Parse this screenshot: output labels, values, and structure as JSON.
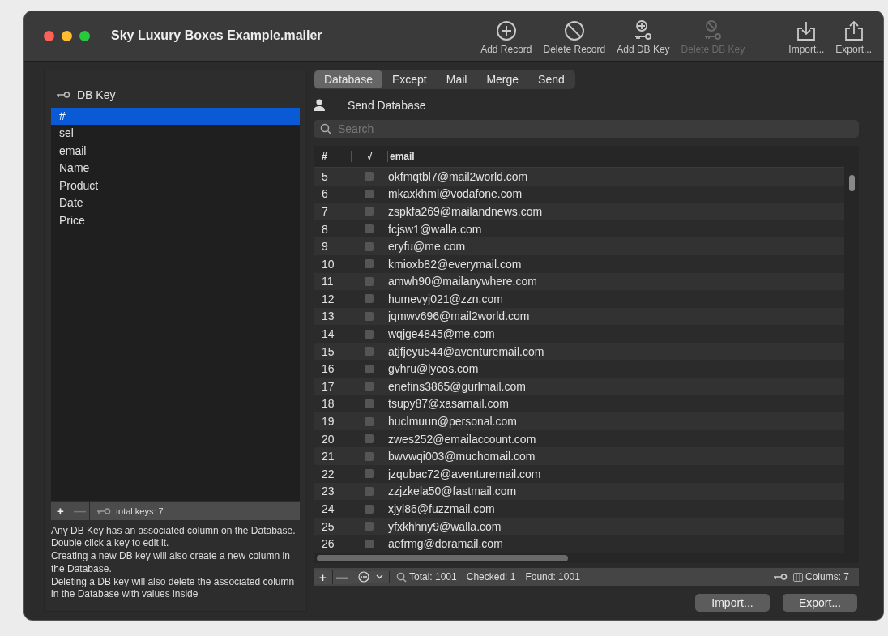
{
  "window": {
    "title": "Sky Luxury Boxes Example.mailer"
  },
  "toolbar": [
    {
      "kind": "add-record",
      "label": "Add Record",
      "disabled": false
    },
    {
      "kind": "delete-record",
      "label": "Delete Record",
      "disabled": false
    },
    {
      "kind": "add-key",
      "label": "Add DB Key",
      "disabled": false
    },
    {
      "kind": "delete-key",
      "label": "Delete DB Key",
      "disabled": true
    },
    {
      "kind": "import",
      "label": "Import...",
      "disabled": false
    },
    {
      "kind": "export",
      "label": "Export...",
      "disabled": false
    }
  ],
  "sidebar": {
    "title": "DB Key",
    "items": [
      {
        "label": "#",
        "selected": true
      },
      {
        "label": "sel",
        "selected": false
      },
      {
        "label": "email",
        "selected": false
      },
      {
        "label": "Name",
        "selected": false
      },
      {
        "label": "Product",
        "selected": false
      },
      {
        "label": "Date",
        "selected": false
      },
      {
        "label": "Price",
        "selected": false
      }
    ],
    "footer": {
      "add": "+",
      "remove": "—",
      "count": "total keys: 7"
    },
    "help": [
      "Any DB Key has an associated column on the Database. Double click a key to edit it.",
      "Creating a new DB key will also create a new column in the Database.",
      "Deleting a DB key will also delete the associated column in the Database with values inside"
    ]
  },
  "tabs": [
    {
      "label": "Database",
      "selected": true
    },
    {
      "label": "Except",
      "selected": false
    },
    {
      "label": "Mail",
      "selected": false
    },
    {
      "label": "Merge",
      "selected": false
    },
    {
      "label": "Send",
      "selected": false
    }
  ],
  "section_title": "Send Database",
  "search": {
    "placeholder": "Search"
  },
  "table": {
    "columns": [
      "#",
      "√",
      "email"
    ],
    "rows": [
      {
        "n": "5",
        "checked": false,
        "email": "okfmqtbl7@mail2world.com"
      },
      {
        "n": "6",
        "checked": false,
        "email": "mkaxkhml@vodafone.com"
      },
      {
        "n": "7",
        "checked": false,
        "email": "zspkfa269@mailandnews.com"
      },
      {
        "n": "8",
        "checked": false,
        "email": "fcjsw1@walla.com"
      },
      {
        "n": "9",
        "checked": false,
        "email": "eryfu@me.com"
      },
      {
        "n": "10",
        "checked": false,
        "email": "kmioxb82@everymail.com"
      },
      {
        "n": "11",
        "checked": false,
        "email": "amwh90@mailanywhere.com"
      },
      {
        "n": "12",
        "checked": false,
        "email": "humevyj021@zzn.com"
      },
      {
        "n": "13",
        "checked": false,
        "email": "jqmwv696@mail2world.com"
      },
      {
        "n": "14",
        "checked": false,
        "email": "wqjge4845@me.com"
      },
      {
        "n": "15",
        "checked": false,
        "email": "atjfjeyu544@aventuremail.com"
      },
      {
        "n": "16",
        "checked": false,
        "email": "gvhru@lycos.com"
      },
      {
        "n": "17",
        "checked": false,
        "email": "enefins3865@gurlmail.com"
      },
      {
        "n": "18",
        "checked": false,
        "email": "tsupy87@xasamail.com"
      },
      {
        "n": "19",
        "checked": false,
        "email": "huclmuun@personal.com"
      },
      {
        "n": "20",
        "checked": false,
        "email": "zwes252@emailaccount.com"
      },
      {
        "n": "21",
        "checked": false,
        "email": "bwvwqi003@muchomail.com"
      },
      {
        "n": "22",
        "checked": false,
        "email": "jzqubac72@aventuremail.com"
      },
      {
        "n": "23",
        "checked": false,
        "email": "zzjzkela50@fastmail.com"
      },
      {
        "n": "24",
        "checked": false,
        "email": "xjyl86@fuzzmail.com"
      },
      {
        "n": "25",
        "checked": false,
        "email": "yfxkhhny9@walla.com"
      },
      {
        "n": "26",
        "checked": false,
        "email": "aefrmg@doramail.com"
      }
    ]
  },
  "status_bar": {
    "add": "+",
    "remove": "—",
    "total": "Total: 1001",
    "checked": "Checked: 1",
    "found": "Found: 1001",
    "columns": "Colums: 7"
  },
  "buttons": [
    "Import...",
    "Export..."
  ]
}
